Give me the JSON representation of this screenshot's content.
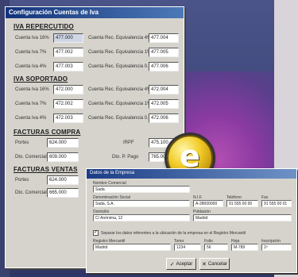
{
  "back_window": {
    "title": "Configuración Cuentas de Iva",
    "sections": [
      {
        "title": "IVA REPERCUTIDO",
        "rows": [
          {
            "l1": "Cuenta Iva 16%",
            "v1": "477.000",
            "l2": "Cuenta Rec. Equivalencia 4%",
            "v2": "477.004"
          },
          {
            "l1": "Cuenta Iva 7%",
            "v1": "477.002",
            "l2": "Cuenta Rec. Equivalencia 1%",
            "v2": "477.005"
          },
          {
            "l1": "Cuenta Iva 4%",
            "v1": "477.003",
            "l2": "Cuenta Rec. Equivalencia 0.5%",
            "v2": "477.006"
          }
        ]
      },
      {
        "title": "IVA SOPORTADO",
        "rows": [
          {
            "l1": "Cuenta Iva 16%",
            "v1": "472.000",
            "l2": "Cuenta Rec. Equivalencia 4%",
            "v2": "472.004"
          },
          {
            "l1": "Cuenta Iva 7%",
            "v1": "472.002",
            "l2": "Cuenta Rec. Equivalencia 1%",
            "v2": "472.005"
          },
          {
            "l1": "Cuenta Iva 4%",
            "v1": "472.003",
            "l2": "Cuenta Rec. Equivalencia 0.5%",
            "v2": "472.006"
          }
        ]
      },
      {
        "title": "FACTURAS COMPRA",
        "rows": [
          {
            "l1": "Portes",
            "v1": "624.000",
            "l2": "IRPF",
            "v2": "475.100"
          },
          {
            "l1": "Dto. Comercial",
            "v1": "609.000",
            "l2": "Dto. P. Pago",
            "v2": "765.000"
          }
        ]
      },
      {
        "title": "FACTURAS VENTAS",
        "rows": [
          {
            "l1": "Portes",
            "v1": "624.000",
            "l2": "",
            "v2": ""
          },
          {
            "l1": "Dto. Comercial",
            "v1": "665.000",
            "l2": "",
            "v2": ""
          }
        ]
      }
    ]
  },
  "front_window": {
    "title": "Datos de la Empresa",
    "fields": {
      "nombre_label": "Nombre Comercial",
      "nombre_value": "Sada",
      "razon_label": "Denominación Social",
      "razon_value": "Sada, S.A.",
      "nif_label": "N.I.F.",
      "nif_value": "A-28000000",
      "telefono_label": "Teléfono",
      "telefono_value": "91 555 00 00",
      "fax_label": "Fax",
      "fax_value": "91 555 00 01",
      "domicilio_label": "Domicilio",
      "domicilio_value": "C/ Anónima, 12",
      "poblacion_label": "Población",
      "poblacion_value": "Madrid",
      "check_label": "Separar los datos referentes a la ubicación de la empresa en el Registro Mercantil",
      "registro_label": "Registro Mercantil",
      "registro_value": "Madrid",
      "tomo_label": "Tomo",
      "tomo_value": "1234",
      "folio_label": "Folio",
      "folio_value": "56",
      "hoja_label": "Hoja",
      "hoja_value": "M-789",
      "inscripcion_label": "Inscripción",
      "inscripcion_value": "1ª"
    },
    "buttons": {
      "accept": "Aceptar",
      "cancel": "Cancelar"
    }
  },
  "logo": {
    "letter": "e",
    "color": "#f2cd2a"
  },
  "colors": {
    "titlebar": "#12337a",
    "window": "#d6d3cc",
    "background": "#4a5488",
    "accent": "#b34fb3"
  }
}
